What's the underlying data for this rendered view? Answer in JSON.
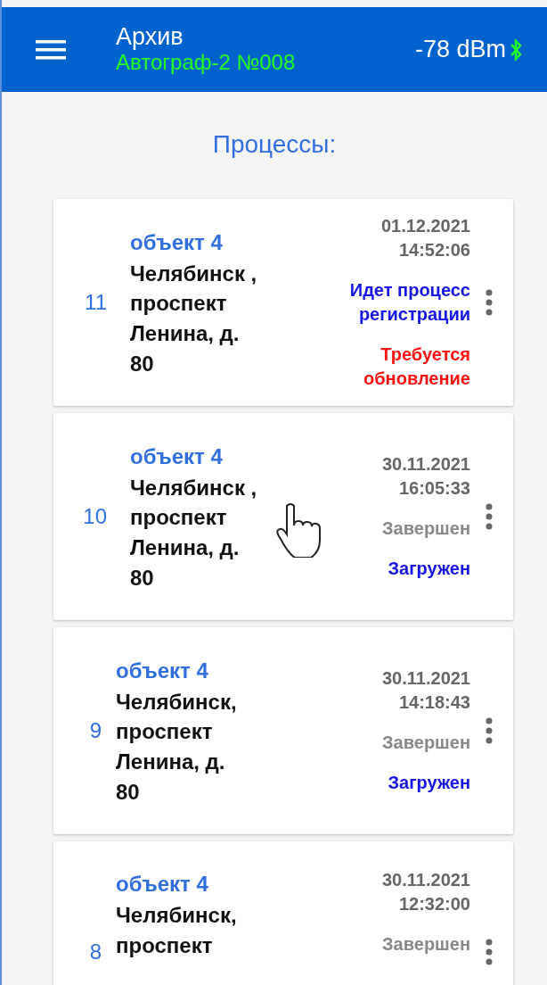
{
  "app_bar": {
    "title": "Архив",
    "subtitle": "Автограф-2 №008",
    "signal": "-78 dBm"
  },
  "heading": "Процессы:",
  "processes": [
    {
      "number": "11",
      "object": "объект 4",
      "address": "Челябинск , проспект Ленина, д. 80",
      "date": "01.12.2021",
      "time": "14:52:06",
      "statuses": [
        {
          "text": "Идет процесс регистрации",
          "kind": "progress"
        },
        {
          "text": "Требуется обновление",
          "kind": "error"
        }
      ]
    },
    {
      "number": "10",
      "object": "объект 4",
      "address": "Челябинск , проспект Ленина, д. 80",
      "date": "30.11.2021",
      "time": "16:05:33",
      "statuses": [
        {
          "text": "Завершен",
          "kind": "done"
        },
        {
          "text": "Загружен",
          "kind": "loaded"
        }
      ]
    },
    {
      "number": "9",
      "object": "объект 4",
      "address": "Челябинск, проспект Ленина, д. 80",
      "date": "30.11.2021",
      "time": "14:18:43",
      "statuses": [
        {
          "text": "Завершен",
          "kind": "done"
        },
        {
          "text": "Загружен",
          "kind": "loaded"
        }
      ]
    },
    {
      "number": "8",
      "object": "объект 4",
      "address": "Челябинск, проспект",
      "date": "30.11.2021",
      "time": "12:32:00",
      "statuses": [
        {
          "text": "Завершен",
          "kind": "done"
        }
      ]
    }
  ]
}
